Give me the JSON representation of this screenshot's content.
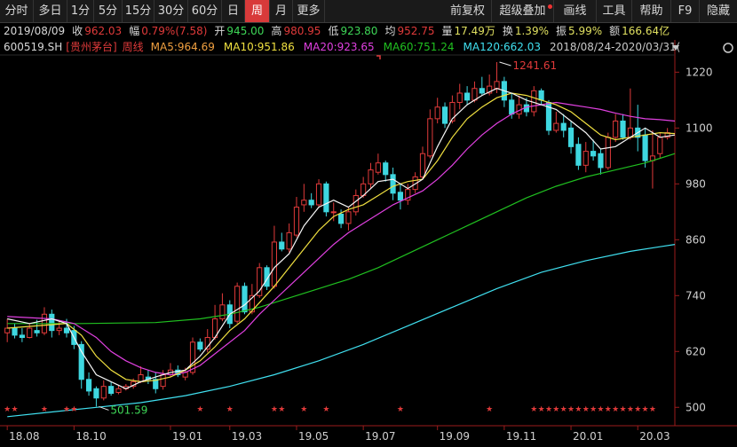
{
  "toolbar": {
    "items": [
      "分时",
      "多日",
      "1分",
      "5分",
      "15分",
      "30分",
      "60分",
      "日",
      "周",
      "月",
      "更多"
    ],
    "active_index": 8,
    "right_items": [
      "前复权",
      "超级叠加",
      "画线",
      "工具",
      "帮助",
      "F9",
      "隐藏"
    ]
  },
  "info_row": {
    "date": "2019/08/09",
    "close_label": "收",
    "close_value": "962.03",
    "range_label": "幅",
    "range_value": "0.79%(7.58)",
    "open_label": "开",
    "open_value": "945.00",
    "high_label": "高",
    "high_value": "980.95",
    "low_label": "低",
    "low_value": "923.80",
    "avg_label": "均",
    "avg_value": "952.75",
    "vol_label": "量",
    "vol_value": "17.49万",
    "turn_label": "换",
    "turn_value": "1.39%",
    "amp_label": "振",
    "amp_value": "5.99%",
    "amount_label": "额",
    "amount_value": "166.64亿"
  },
  "legend_row": {
    "code": "600519.SH",
    "name": "[贵州茅台]",
    "period": "周线",
    "ma5": "MA5:964.69",
    "ma10": "MA10:951.86",
    "ma20": "MA20:923.65",
    "ma60": "MA60:751.24",
    "ma120": "MA120:662.03",
    "range": "2018/08/24-2020/03/31("
  },
  "colors": {
    "up": "#e03a3a",
    "down": "#3ed7e0",
    "ma5": "#f5f5f5",
    "ma10": "#f0e040",
    "ma20": "#e040e0",
    "ma60": "#20c020",
    "ma120": "#40e0f0",
    "accent": "#d83a3a"
  },
  "chart_data": {
    "type": "candlestick",
    "y_ticks": [
      1220,
      1100,
      980,
      860,
      740,
      620,
      500
    ],
    "ylim": [
      470,
      1255
    ],
    "x_labels": [
      {
        "label": "18.08",
        "at": 0
      },
      {
        "label": "18.10",
        "at": 9
      },
      {
        "label": "19.01",
        "at": 22
      },
      {
        "label": "19.03",
        "at": 30
      },
      {
        "label": "19.05",
        "at": 39
      },
      {
        "label": "19.07",
        "at": 48
      },
      {
        "label": "19.09",
        "at": 58
      },
      {
        "label": "19.11",
        "at": 67
      },
      {
        "label": "20.01",
        "at": 76
      },
      {
        "label": "20.03",
        "at": 85
      }
    ],
    "high_annotation": "1241.61",
    "low_annotation": "501.59",
    "candles": [
      [
        660,
        670,
        690,
        640
      ],
      [
        670,
        655,
        680,
        648
      ],
      [
        655,
        650,
        670,
        640
      ],
      [
        650,
        670,
        680,
        648
      ],
      [
        665,
        660,
        688,
        652
      ],
      [
        660,
        700,
        715,
        655
      ],
      [
        700,
        665,
        710,
        650
      ],
      [
        665,
        670,
        685,
        655
      ],
      [
        670,
        660,
        690,
        650
      ],
      [
        665,
        635,
        675,
        625
      ],
      [
        635,
        560,
        642,
        540
      ],
      [
        560,
        535,
        575,
        525
      ],
      [
        540,
        520,
        545,
        501.59
      ],
      [
        520,
        545,
        558,
        515
      ],
      [
        545,
        530,
        555,
        525
      ],
      [
        532,
        540,
        548,
        528
      ],
      [
        540,
        545,
        550,
        536
      ],
      [
        545,
        555,
        562,
        540
      ],
      [
        555,
        570,
        588,
        552
      ],
      [
        565,
        560,
        580,
        550
      ],
      [
        560,
        540,
        575,
        530
      ],
      [
        545,
        570,
        580,
        538
      ],
      [
        570,
        580,
        595,
        565
      ],
      [
        580,
        570,
        590,
        565
      ],
      [
        565,
        575,
        585,
        558
      ],
      [
        575,
        640,
        650,
        570
      ],
      [
        640,
        625,
        648,
        620
      ],
      [
        625,
        650,
        668,
        618
      ],
      [
        650,
        690,
        720,
        645
      ],
      [
        690,
        720,
        745,
        685
      ],
      [
        720,
        680,
        730,
        670
      ],
      [
        685,
        760,
        768,
        680
      ],
      [
        760,
        705,
        768,
        700
      ],
      [
        705,
        740,
        765,
        700
      ],
      [
        740,
        800,
        810,
        735
      ],
      [
        800,
        760,
        805,
        752
      ],
      [
        760,
        855,
        890,
        755
      ],
      [
        855,
        840,
        875,
        835
      ],
      [
        840,
        875,
        895,
        833
      ],
      [
        870,
        930,
        952,
        865
      ],
      [
        935,
        945,
        980,
        920
      ],
      [
        945,
        935,
        960,
        928
      ],
      [
        935,
        980,
        990,
        930
      ],
      [
        980,
        920,
        985,
        910
      ],
      [
        920,
        920,
        940,
        900
      ],
      [
        915,
        895,
        925,
        885
      ],
      [
        895,
        920,
        930,
        880
      ],
      [
        920,
        955,
        968,
        912
      ],
      [
        955,
        980,
        995,
        950
      ],
      [
        980,
        1010,
        1025,
        970
      ],
      [
        1005,
        1025,
        1045,
        1000
      ],
      [
        1025,
        1000,
        1030,
        985
      ],
      [
        1000,
        960,
        1015,
        945
      ],
      [
        962,
        945,
        980,
        925
      ],
      [
        945,
        968,
        980,
        935
      ],
      [
        968,
        995,
        1005,
        960
      ],
      [
        995,
        1045,
        1060,
        990
      ],
      [
        1040,
        1120,
        1140,
        1035
      ],
      [
        1120,
        1145,
        1165,
        1110
      ],
      [
        1145,
        1110,
        1155,
        1100
      ],
      [
        1115,
        1155,
        1170,
        1110
      ],
      [
        1155,
        1175,
        1195,
        1140
      ],
      [
        1175,
        1160,
        1190,
        1150
      ],
      [
        1160,
        1185,
        1200,
        1155
      ],
      [
        1185,
        1175,
        1210,
        1170
      ],
      [
        1175,
        1190,
        1215,
        1170
      ],
      [
        1185,
        1200,
        1241.61,
        1175
      ],
      [
        1200,
        1160,
        1210,
        1145
      ],
      [
        1160,
        1130,
        1175,
        1120
      ],
      [
        1130,
        1150,
        1170,
        1120
      ],
      [
        1150,
        1135,
        1165,
        1125
      ],
      [
        1135,
        1180,
        1190,
        1125
      ],
      [
        1180,
        1160,
        1185,
        1150
      ],
      [
        1155,
        1095,
        1160,
        1085
      ],
      [
        1095,
        1110,
        1135,
        1090
      ],
      [
        1110,
        1095,
        1130,
        1080
      ],
      [
        1100,
        1060,
        1115,
        1045
      ],
      [
        1065,
        1020,
        1080,
        1010
      ],
      [
        1020,
        1050,
        1070,
        1005
      ],
      [
        1050,
        1040,
        1075,
        1030
      ],
      [
        1045,
        1015,
        1055,
        1000
      ],
      [
        1015,
        1080,
        1090,
        1010
      ],
      [
        1080,
        1115,
        1130,
        1070
      ],
      [
        1115,
        1080,
        1130,
        1075
      ],
      [
        1080,
        1100,
        1185,
        1075
      ],
      [
        1100,
        1080,
        1150,
        1050
      ],
      [
        1085,
        1030,
        1100,
        1015
      ],
      [
        1030,
        1040,
        1095,
        970
      ],
      [
        1045,
        1080,
        1090,
        1035
      ],
      [
        1080,
        1090,
        1100,
        1075
      ]
    ],
    "ma5": [
      [
        0,
        690
      ],
      [
        3,
        680
      ],
      [
        6,
        690
      ],
      [
        8,
        680
      ],
      [
        10,
        620
      ],
      [
        12,
        570
      ],
      [
        14,
        555
      ],
      [
        16,
        540
      ],
      [
        18,
        555
      ],
      [
        20,
        565
      ],
      [
        22,
        575
      ],
      [
        24,
        580
      ],
      [
        26,
        610
      ],
      [
        28,
        650
      ],
      [
        30,
        700
      ],
      [
        32,
        720
      ],
      [
        34,
        750
      ],
      [
        36,
        800
      ],
      [
        38,
        830
      ],
      [
        40,
        890
      ],
      [
        42,
        930
      ],
      [
        44,
        945
      ],
      [
        46,
        930
      ],
      [
        48,
        955
      ],
      [
        50,
        985
      ],
      [
        52,
        990
      ],
      [
        54,
        970
      ],
      [
        56,
        990
      ],
      [
        58,
        1060
      ],
      [
        60,
        1120
      ],
      [
        62,
        1150
      ],
      [
        64,
        1170
      ],
      [
        66,
        1185
      ],
      [
        68,
        1175
      ],
      [
        70,
        1160
      ],
      [
        72,
        1150
      ],
      [
        74,
        1140
      ],
      [
        76,
        1115
      ],
      [
        78,
        1090
      ],
      [
        80,
        1055
      ],
      [
        82,
        1060
      ],
      [
        84,
        1080
      ],
      [
        86,
        1100
      ],
      [
        88,
        1080
      ],
      [
        90,
        1085
      ]
    ],
    "ma10": [
      [
        0,
        670
      ],
      [
        4,
        675
      ],
      [
        8,
        680
      ],
      [
        10,
        655
      ],
      [
        12,
        610
      ],
      [
        14,
        580
      ],
      [
        16,
        560
      ],
      [
        18,
        555
      ],
      [
        20,
        558
      ],
      [
        22,
        565
      ],
      [
        24,
        580
      ],
      [
        26,
        600
      ],
      [
        28,
        630
      ],
      [
        30,
        665
      ],
      [
        32,
        690
      ],
      [
        34,
        725
      ],
      [
        36,
        760
      ],
      [
        38,
        800
      ],
      [
        40,
        840
      ],
      [
        42,
        880
      ],
      [
        44,
        910
      ],
      [
        46,
        925
      ],
      [
        48,
        935
      ],
      [
        50,
        955
      ],
      [
        52,
        975
      ],
      [
        54,
        985
      ],
      [
        56,
        990
      ],
      [
        58,
        1030
      ],
      [
        60,
        1080
      ],
      [
        62,
        1120
      ],
      [
        64,
        1145
      ],
      [
        66,
        1165
      ],
      [
        68,
        1175
      ],
      [
        70,
        1170
      ],
      [
        72,
        1160
      ],
      [
        74,
        1150
      ],
      [
        76,
        1135
      ],
      [
        78,
        1110
      ],
      [
        80,
        1085
      ],
      [
        82,
        1075
      ],
      [
        84,
        1080
      ],
      [
        86,
        1085
      ],
      [
        88,
        1090
      ],
      [
        90,
        1088
      ]
    ],
    "ma20": [
      [
        0,
        695
      ],
      [
        6,
        690
      ],
      [
        9,
        680
      ],
      [
        12,
        650
      ],
      [
        14,
        620
      ],
      [
        16,
        600
      ],
      [
        18,
        585
      ],
      [
        20,
        575
      ],
      [
        22,
        570
      ],
      [
        24,
        575
      ],
      [
        26,
        590
      ],
      [
        28,
        615
      ],
      [
        30,
        640
      ],
      [
        32,
        665
      ],
      [
        34,
        700
      ],
      [
        36,
        730
      ],
      [
        38,
        760
      ],
      [
        40,
        790
      ],
      [
        42,
        820
      ],
      [
        44,
        850
      ],
      [
        46,
        875
      ],
      [
        48,
        895
      ],
      [
        50,
        915
      ],
      [
        52,
        935
      ],
      [
        54,
        950
      ],
      [
        56,
        965
      ],
      [
        58,
        990
      ],
      [
        60,
        1020
      ],
      [
        62,
        1055
      ],
      [
        64,
        1085
      ],
      [
        66,
        1110
      ],
      [
        68,
        1130
      ],
      [
        70,
        1145
      ],
      [
        72,
        1150
      ],
      [
        74,
        1155
      ],
      [
        76,
        1150
      ],
      [
        78,
        1145
      ],
      [
        80,
        1140
      ],
      [
        82,
        1132
      ],
      [
        84,
        1125
      ],
      [
        86,
        1120
      ],
      [
        88,
        1118
      ],
      [
        90,
        1115
      ]
    ],
    "ma60": [
      [
        0,
        680
      ],
      [
        10,
        680
      ],
      [
        20,
        682
      ],
      [
        26,
        690
      ],
      [
        30,
        700
      ],
      [
        34,
        715
      ],
      [
        38,
        735
      ],
      [
        42,
        755
      ],
      [
        46,
        775
      ],
      [
        50,
        800
      ],
      [
        54,
        830
      ],
      [
        58,
        860
      ],
      [
        62,
        890
      ],
      [
        66,
        920
      ],
      [
        70,
        950
      ],
      [
        74,
        975
      ],
      [
        78,
        995
      ],
      [
        82,
        1010
      ],
      [
        86,
        1025
      ],
      [
        88,
        1035
      ],
      [
        90,
        1045
      ]
    ],
    "ma120": [
      [
        0,
        480
      ],
      [
        6,
        490
      ],
      [
        12,
        500
      ],
      [
        18,
        510
      ],
      [
        24,
        525
      ],
      [
        30,
        545
      ],
      [
        36,
        570
      ],
      [
        42,
        600
      ],
      [
        48,
        635
      ],
      [
        54,
        675
      ],
      [
        60,
        715
      ],
      [
        66,
        755
      ],
      [
        72,
        790
      ],
      [
        78,
        815
      ],
      [
        84,
        835
      ],
      [
        88,
        845
      ],
      [
        90,
        850
      ]
    ],
    "star_positions": [
      0,
      1,
      5,
      8,
      9,
      26,
      30,
      36,
      37,
      40,
      43,
      53,
      65,
      71,
      72,
      73,
      74,
      75,
      76,
      77,
      78,
      79,
      80,
      81,
      82,
      83,
      84,
      85,
      86,
      87
    ]
  }
}
